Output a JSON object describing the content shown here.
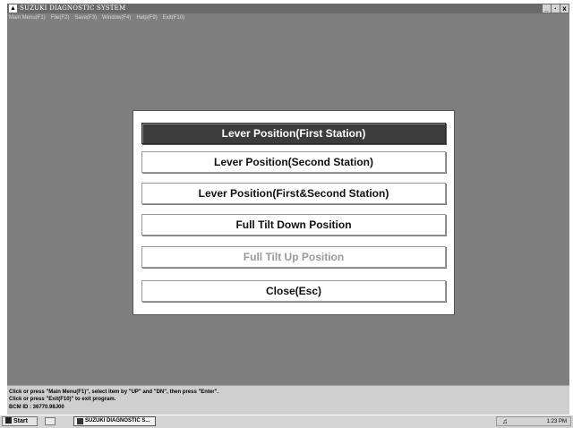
{
  "window": {
    "title": "SUZUKI DIAGNOSTIC SYSTEM",
    "controls": [
      "_",
      "·",
      "x"
    ]
  },
  "menubar": {
    "items": [
      {
        "label": "Main Menu(F1)"
      },
      {
        "label": "File(F2)"
      },
      {
        "label": "Save(F3)"
      },
      {
        "label": "Window(F4)"
      },
      {
        "label": "Help(F9)"
      },
      {
        "label": "Exit(F10)"
      }
    ]
  },
  "dialog": {
    "options": [
      {
        "label": "Lever Position(First Station)",
        "state": "selected"
      },
      {
        "label": "Lever Position(Second Station)",
        "state": "normal"
      },
      {
        "label": "Lever Position(First&Second Station)",
        "state": "normal"
      },
      {
        "label": "Full Tilt Down Position",
        "state": "normal"
      },
      {
        "label": "Full Tilt Up Position",
        "state": "disabled"
      },
      {
        "label": "Close(Esc)",
        "state": "normal"
      }
    ]
  },
  "statusbar": {
    "line1": "Click or press \"Main Menu(F1)\", select item by \"UP\" and \"DN\", then press \"Enter\".",
    "line2": "Click or press \"Exit(F10)\" to exit program.",
    "line3": "BCM ID : 36770.98J00"
  },
  "taskbar": {
    "start_label": "Start",
    "task_label": "SUZUKI DIAGNOSTIC S...",
    "clock": "1:23 PM"
  },
  "colors": {
    "desktop": "#7f7f7f",
    "selected_option": "#3c3c3c",
    "disabled_text": "#9a9a9a"
  }
}
